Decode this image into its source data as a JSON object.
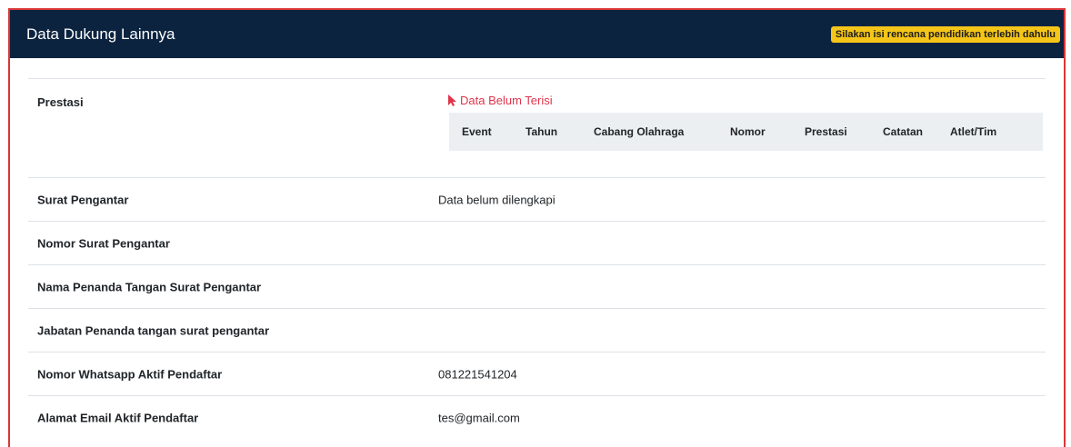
{
  "header": {
    "title": "Data Dukung Lainnya",
    "warning": "Silakan isi rencana pendidikan terlebih dahulu"
  },
  "prestasi": {
    "label": "Prestasi",
    "empty_text": "Data Belum Terisi",
    "columns": [
      "Event",
      "Tahun",
      "Cabang Olahraga",
      "Nomor",
      "Prestasi",
      "Catatan",
      "Atlet/Tim"
    ]
  },
  "rows": [
    {
      "label": "Surat Pengantar",
      "value": "Data belum dilengkapi"
    },
    {
      "label": "Nomor Surat Pengantar",
      "value": ""
    },
    {
      "label": "Nama Penanda Tangan Surat Pengantar",
      "value": ""
    },
    {
      "label": "Jabatan Penanda tangan surat pengantar",
      "value": ""
    },
    {
      "label": "Nomor Whatsapp Aktif Pendaftar",
      "value": "081221541204"
    },
    {
      "label": "Alamat Email Aktif Pendaftar",
      "value": "tes@gmail.com"
    }
  ],
  "colors": {
    "header_bg": "#0c2340",
    "warning_bg": "#f5c518",
    "empty_text": "#e0344b",
    "border_accent": "#d93636"
  },
  "icons": {
    "empty_flag": "pointer-arrow-icon"
  }
}
